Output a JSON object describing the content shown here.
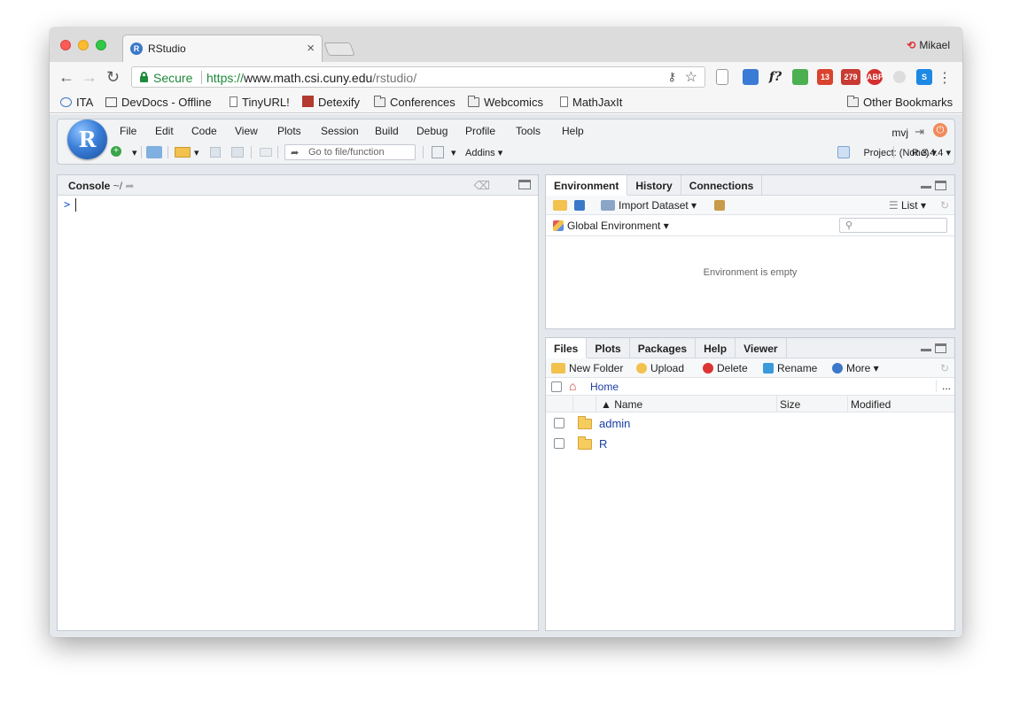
{
  "browser": {
    "tab_title": "RStudio",
    "tab_close": "×",
    "profile_name": "Mikael",
    "secure_label": "Secure",
    "url_scheme": "https://",
    "url_host": "www.math.csi.cuny.edu",
    "url_path": "/rstudio/",
    "ext_badges": [
      "13",
      "279",
      "ABP"
    ],
    "bookmarks": [
      "ITA",
      "DevDocs - Offline",
      "TinyURL!",
      "Detexify",
      "Conferences",
      "Webcomics",
      "MathJaxIt"
    ],
    "other_bookmarks": "Other Bookmarks"
  },
  "rstudio": {
    "logo": "R",
    "menu": [
      "File",
      "Edit",
      "Code",
      "View",
      "Plots",
      "Session",
      "Build",
      "Debug",
      "Profile",
      "Tools",
      "Help"
    ],
    "user": "mvj",
    "goto_placeholder": "Go to file/function",
    "addins": "Addins",
    "project": "Project: (None)",
    "r_version": "R 3.4.4"
  },
  "console": {
    "title": "Console",
    "path": "~/",
    "prompt": ">"
  },
  "environment": {
    "tabs": [
      "Environment",
      "History",
      "Connections"
    ],
    "import_dataset": "Import Dataset",
    "list_label": "List",
    "scope": "Global Environment",
    "empty_message": "Environment is empty"
  },
  "files": {
    "tabs": [
      "Files",
      "Plots",
      "Packages",
      "Help",
      "Viewer"
    ],
    "actions": {
      "new_folder": "New Folder",
      "upload": "Upload",
      "delete": "Delete",
      "rename": "Rename",
      "more": "More"
    },
    "breadcrumb": "Home",
    "overflow": "...",
    "columns": [
      "Name",
      "Size",
      "Modified"
    ],
    "rows": [
      {
        "name": "admin",
        "size": "",
        "modified": ""
      },
      {
        "name": "R",
        "size": "",
        "modified": ""
      }
    ]
  },
  "colors": {
    "secure_green": "#1e8a3a",
    "rstudio_blue": "#3b7fd8",
    "link_blue": "#1a3ea6"
  }
}
